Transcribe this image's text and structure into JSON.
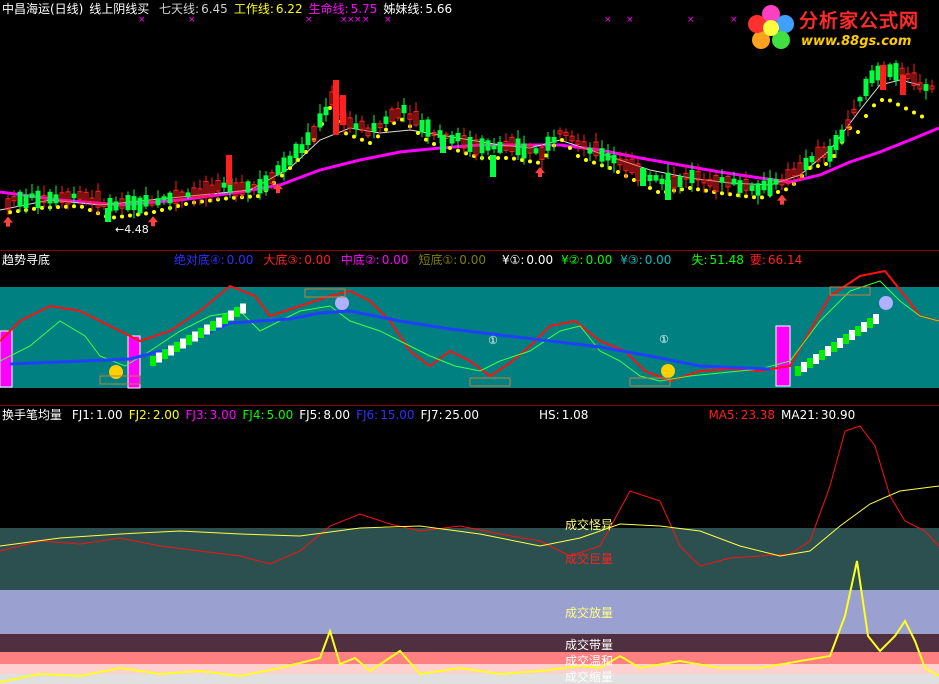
{
  "main": {
    "title": "中昌海运(日线)",
    "indicator_name": "线上阴线买",
    "params": [
      {
        "label": "七天线:",
        "value": "6.45",
        "color": "#cfcfcf"
      },
      {
        "label": "工作线:",
        "value": "6.22",
        "color": "#ffff00"
      },
      {
        "label": "生命线:",
        "value": "5.75",
        "color": "#ff00ff"
      },
      {
        "label": "姊妹线:",
        "value": "5.66",
        "color": "#ffffff"
      }
    ],
    "low_marker": "←4.48",
    "colors": {
      "up": "#ff2020",
      "down": "#00ff40",
      "life": "#ff00ff",
      "work": "#ffff00",
      "seven": "#dddddd"
    }
  },
  "logo": {
    "title": "分析家公式网",
    "url": "www.88gs.com"
  },
  "trend": {
    "title": "趋势寻底",
    "params": [
      {
        "label": "绝对底④:",
        "value": "0.00",
        "color": "#3030ff"
      },
      {
        "label": "大底③:",
        "value": "0.00",
        "color": "#ff2020"
      },
      {
        "label": "中底②:",
        "value": "0.00",
        "color": "#ff00ff"
      },
      {
        "label": "短底①:",
        "value": "0.00",
        "color": "#808000"
      },
      {
        "label": "¥①:",
        "value": "0.00",
        "color": "#ffffff"
      },
      {
        "label": "¥②:",
        "value": "0.00",
        "color": "#00ff00"
      },
      {
        "label": "¥③:",
        "value": "0.00",
        "color": "#00c0c0"
      },
      {
        "label": "失:",
        "value": "51.48",
        "color": "#00ff00"
      },
      {
        "label": "要:",
        "value": "66.14",
        "color": "#ff2020"
      }
    ],
    "markers": [
      "①",
      "①"
    ],
    "teal": "#008080"
  },
  "turnover": {
    "title": "换手笔均量",
    "params": [
      {
        "label": "FJ1:",
        "value": "1.00",
        "color": "#ffffff"
      },
      {
        "label": "FJ2:",
        "value": "2.00",
        "color": "#ffff00"
      },
      {
        "label": "FJ3:",
        "value": "3.00",
        "color": "#ff00ff"
      },
      {
        "label": "FJ4:",
        "value": "5.00",
        "color": "#00ff00"
      },
      {
        "label": "FJ5:",
        "value": "8.00",
        "color": "#ffffff"
      },
      {
        "label": "FJ6:",
        "value": "15.00",
        "color": "#3030ff"
      },
      {
        "label": "FJ7:",
        "value": "25.00",
        "color": "#ffffff"
      },
      {
        "label": "HS:",
        "value": "1.08",
        "color": "#ffffff"
      },
      {
        "label": "MA5:",
        "value": "23.38",
        "color": "#ff2020"
      },
      {
        "label": "MA21:",
        "value": "30.90",
        "color": "#ffffff"
      }
    ],
    "bands": [
      {
        "label": "成交怪异",
        "color": "#ffff80"
      },
      {
        "label": "成交巨量",
        "color": "#ff2020"
      },
      {
        "label": "成交放量",
        "color": "#ffff80"
      },
      {
        "label": "成交带量",
        "color": "#ffffff"
      },
      {
        "label": "成交温和",
        "color": "#ffffff"
      },
      {
        "label": "成交缩量",
        "color": "#ffffff"
      }
    ]
  }
}
